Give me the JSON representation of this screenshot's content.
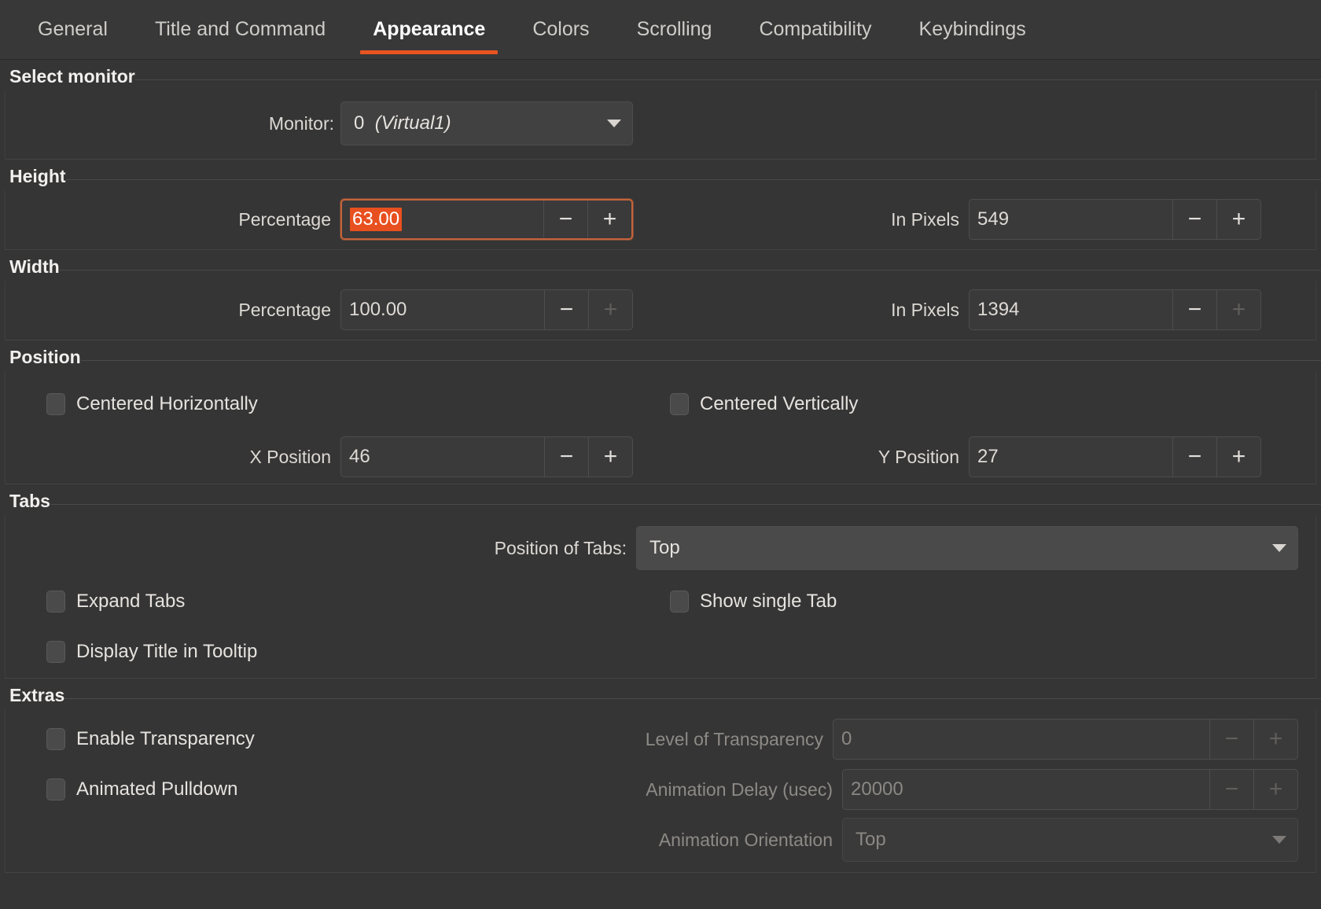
{
  "tabs": [
    {
      "label": "General",
      "active": false
    },
    {
      "label": "Title and Command",
      "active": false
    },
    {
      "label": "Appearance",
      "active": true
    },
    {
      "label": "Colors",
      "active": false
    },
    {
      "label": "Scrolling",
      "active": false
    },
    {
      "label": "Compatibility",
      "active": false
    },
    {
      "label": "Keybindings",
      "active": false
    }
  ],
  "accent_color": "#e95420",
  "selection_color": "#e8501f",
  "select_monitor": {
    "group_title": "Select monitor",
    "monitor_label": "Monitor:",
    "monitor_value_index": "0",
    "monitor_value_name": "(Virtual1)"
  },
  "height": {
    "group_title": "Height",
    "percentage_label": "Percentage",
    "percentage_value": "63.00",
    "pixels_label": "In Pixels",
    "pixels_value": "549",
    "minus": "−",
    "plus": "+"
  },
  "width": {
    "group_title": "Width",
    "percentage_label": "Percentage",
    "percentage_value": "100.00",
    "pixels_label": "In Pixels",
    "pixels_value": "1394",
    "minus": "−",
    "plus": "+"
  },
  "position": {
    "group_title": "Position",
    "centered_horizontally": "Centered Horizontally",
    "centered_vertically": "Centered Vertically",
    "x_label": "X Position",
    "x_value": "46",
    "y_label": "Y Position",
    "y_value": "27",
    "minus": "−",
    "plus": "+"
  },
  "tabs_section": {
    "group_title": "Tabs",
    "position_of_tabs_label": "Position of Tabs:",
    "position_of_tabs_value": "Top",
    "expand_tabs": "Expand Tabs",
    "show_single_tab": "Show single Tab",
    "display_title_in_tooltip": "Display Title in Tooltip"
  },
  "extras": {
    "group_title": "Extras",
    "enable_transparency": "Enable Transparency",
    "level_of_transparency_label": "Level of Transparency",
    "level_of_transparency_value": "0",
    "animated_pulldown": "Animated Pulldown",
    "animation_delay_label": "Animation Delay (usec)",
    "animation_delay_value": "20000",
    "animation_orientation_label": "Animation Orientation",
    "animation_orientation_value": "Top",
    "minus": "−",
    "plus": "+"
  }
}
